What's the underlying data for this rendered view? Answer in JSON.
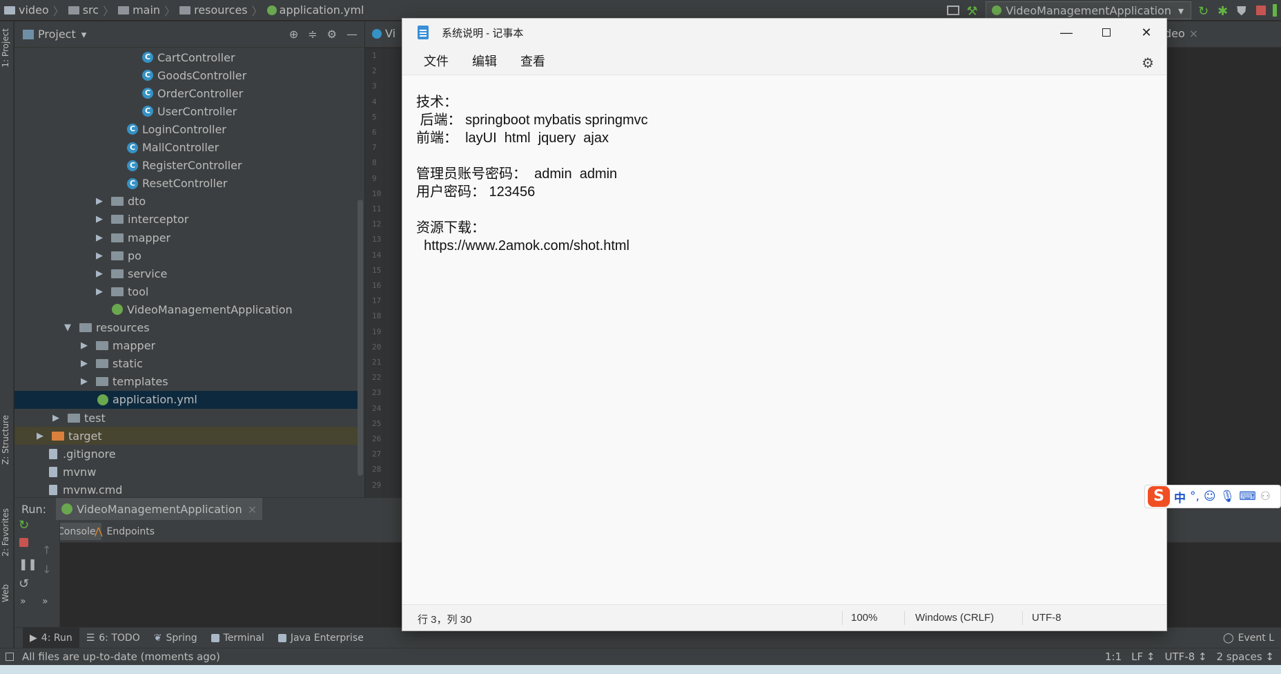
{
  "ide": {
    "breadcrumbs": [
      "video",
      "src",
      "main",
      "resources",
      "application.yml"
    ],
    "run_config": "VideoManagementApplication",
    "project_panel_title": "Project",
    "editor_tab_left": "Vi",
    "editor_tab_right": "deo",
    "left_strip": {
      "project": "1: Project",
      "structure": "Z: Structure",
      "favorites": "2: Favorites",
      "web": "Web"
    },
    "tree": [
      {
        "label": "CartController",
        "kind": "class"
      },
      {
        "label": "GoodsController",
        "kind": "class"
      },
      {
        "label": "OrderController",
        "kind": "class"
      },
      {
        "label": "UserController",
        "kind": "class"
      },
      {
        "label": "LoginController",
        "kind": "class"
      },
      {
        "label": "MallController",
        "kind": "class"
      },
      {
        "label": "RegisterController",
        "kind": "class"
      },
      {
        "label": "ResetController",
        "kind": "class"
      },
      {
        "label": "dto",
        "kind": "folder"
      },
      {
        "label": "interceptor",
        "kind": "folder"
      },
      {
        "label": "mapper",
        "kind": "folder"
      },
      {
        "label": "po",
        "kind": "folder"
      },
      {
        "label": "service",
        "kind": "folder"
      },
      {
        "label": "tool",
        "kind": "folder"
      },
      {
        "label": "VideoManagementApplication",
        "kind": "spring"
      },
      {
        "label": "resources",
        "kind": "folder-open"
      },
      {
        "label": "mapper",
        "kind": "folder"
      },
      {
        "label": "static",
        "kind": "folder"
      },
      {
        "label": "templates",
        "kind": "folder"
      },
      {
        "label": "application.yml",
        "kind": "spring",
        "selected": true
      },
      {
        "label": "test",
        "kind": "folder"
      },
      {
        "label": "target",
        "kind": "folder-orange"
      },
      {
        "label": ".gitignore",
        "kind": "file"
      },
      {
        "label": "mvnw",
        "kind": "file"
      },
      {
        "label": "mvnw.cmd",
        "kind": "file"
      }
    ],
    "line_numbers": [
      "1",
      "2",
      "3",
      "4",
      "5",
      "6",
      "7",
      "8",
      "9",
      "10",
      "11",
      "12",
      "13",
      "14",
      "15",
      "16",
      "17",
      "18",
      "19",
      "20",
      "21",
      "22",
      "23",
      "24",
      "25",
      "26",
      "27",
      "28",
      "29"
    ],
    "run": {
      "label": "Run:",
      "tab": "VideoManagementApplication",
      "console_tab": "Console",
      "endpoints_tab": "Endpoints"
    },
    "bottom_tools": [
      "4: Run",
      "6: TODO",
      "Spring",
      "Terminal",
      "Java Enterprise"
    ],
    "event_log": "Event L",
    "status": {
      "message": "All files are up-to-date (moments ago)",
      "position": "1:1",
      "line_sep": "LF ↕",
      "encoding": "UTF-8 ↕",
      "indent": "2 spaces ↕"
    }
  },
  "notepad": {
    "title": "系统说明 - 记事本",
    "menu": [
      "文件",
      "编辑",
      "查看"
    ],
    "lines": [
      "技术：",
      " 后端： springboot mybatis springmvc",
      "前端：  layUI  html  jquery  ajax",
      "",
      "管理员账号密码：  admin  admin",
      "用户密码： 123456",
      "",
      "资源下载：",
      "  https://www.2amok.com/shot.html"
    ],
    "status": {
      "cursor": "行 3，列 30",
      "zoom": "100%",
      "line_ending": "Windows (CRLF)",
      "encoding": "UTF-8"
    }
  },
  "ime": {
    "logo": "S",
    "mode": "中",
    "punct": "°,"
  }
}
